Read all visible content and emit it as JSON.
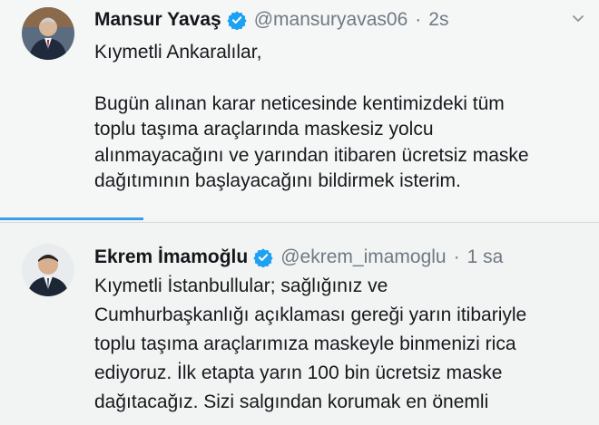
{
  "tweets": [
    {
      "name": "Mansur Yavaş",
      "handle": "@mansuryavas06",
      "separator": "·",
      "time": "2s",
      "avatar_icon": "profile-photo-man-suit",
      "lines_before_gap": [
        "Kıymetli Ankaralılar,"
      ],
      "lines_after_gap": [
        "Bugün alınan karar neticesinde kentimizdeki tüm",
        "toplu taşıma araçlarında maskesiz yolcu",
        "alınmayacağını ve yarından itibaren ücretsiz maske",
        "dağıtımının başlayacağını bildirmek isterim."
      ]
    },
    {
      "name": "Ekrem İmamoğlu",
      "handle": "@ekrem_imamoglu",
      "separator": "·",
      "time": "1 sa",
      "avatar_icon": "profile-photo-man-suit",
      "lines": [
        "Kıymetli İstanbullular; sağlığınız ve",
        "Cumhurbaşkanlığı açıklaması gereği yarın itibariyle",
        "toplu taşıma araçlarımıza maskeyle binmenizi rica",
        "ediyoruz. İlk etapta yarın 100 bin ücretsiz maske",
        "dağıtacağız. Sizi salgından korumak en önemli"
      ]
    }
  ],
  "colors": {
    "verified_blue": "#1da1f2",
    "handle_gray": "#6e7a84",
    "accent_bar": "#3c9ee8"
  }
}
